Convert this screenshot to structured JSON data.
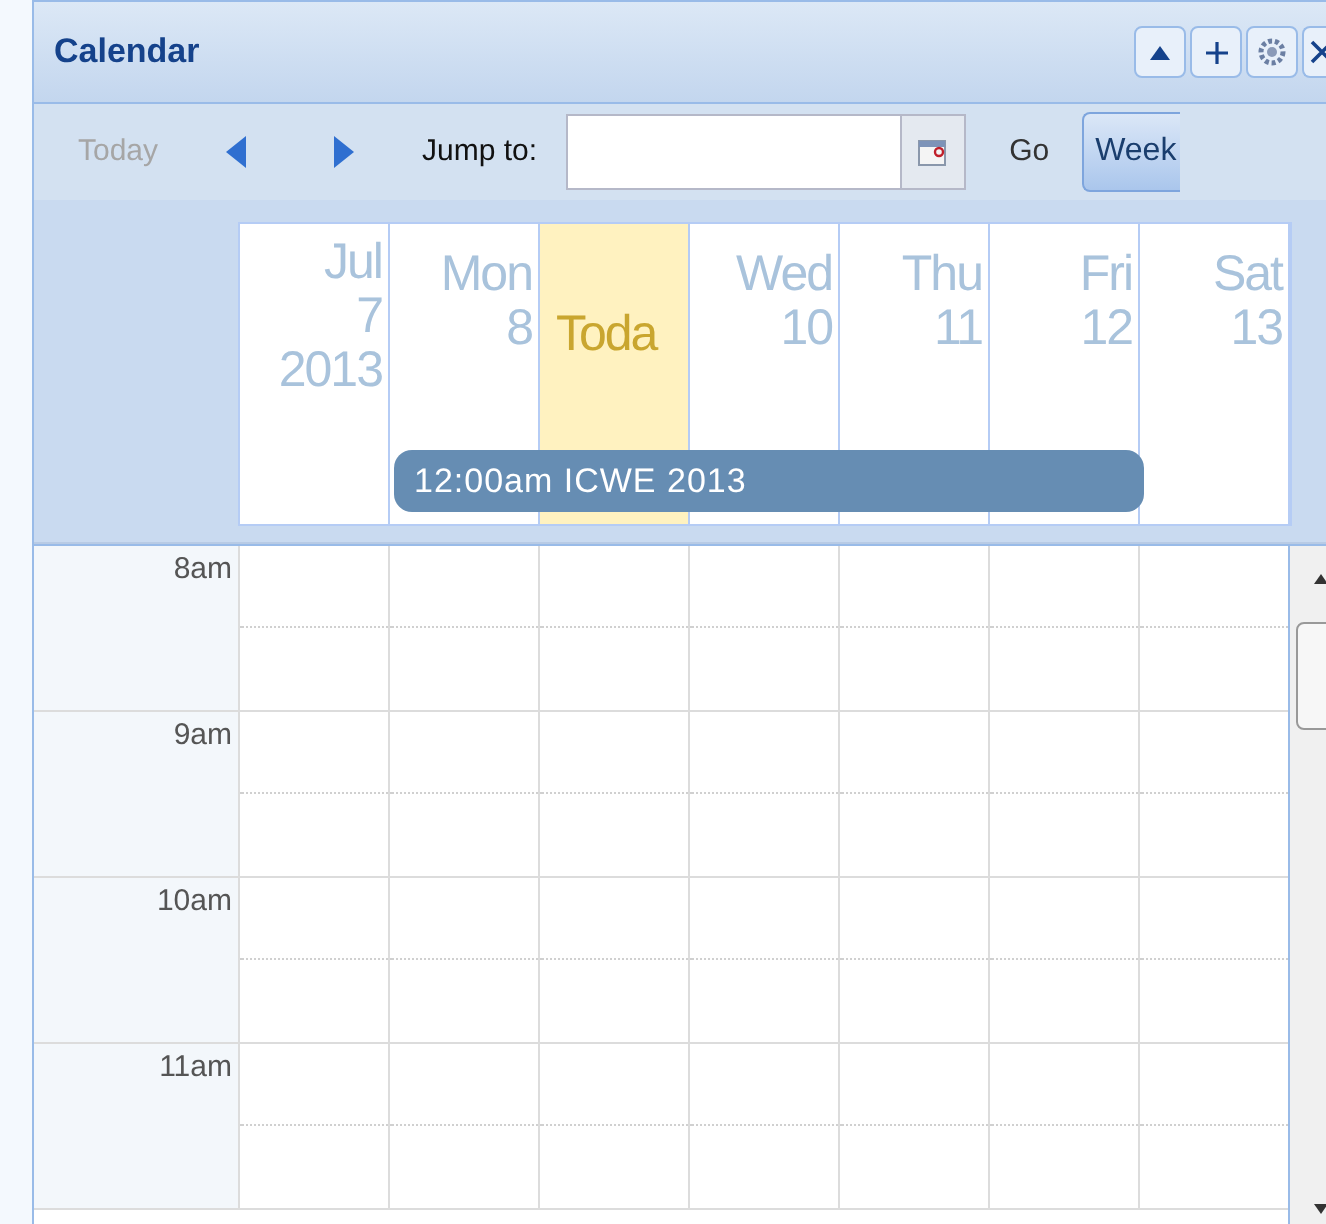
{
  "window": {
    "title": "Calendar"
  },
  "toolbar": {
    "today": {
      "label": "Today",
      "disabled": true
    },
    "jump_label": "Jump to:",
    "go": "Go",
    "view": {
      "label": "Week",
      "selected": true
    }
  },
  "days": [
    {
      "lines": [
        "Jul",
        "7",
        "2013"
      ],
      "selected": false
    },
    {
      "lines": [
        "Mon",
        "8"
      ],
      "selected": false
    },
    {
      "lines": [
        "Toda"
      ],
      "selected": true
    },
    {
      "lines": [
        "Wed",
        "10"
      ],
      "selected": false
    },
    {
      "lines": [
        "Thu",
        "11"
      ],
      "selected": false
    },
    {
      "lines": [
        "Fri",
        "12"
      ],
      "selected": false
    },
    {
      "lines": [
        "Sat",
        "13"
      ],
      "selected": false
    }
  ],
  "all_day_events": [
    {
      "text": "12:00am ICWE 2013"
    }
  ],
  "hours": [
    "8am",
    "9am",
    "10am",
    "11am"
  ]
}
